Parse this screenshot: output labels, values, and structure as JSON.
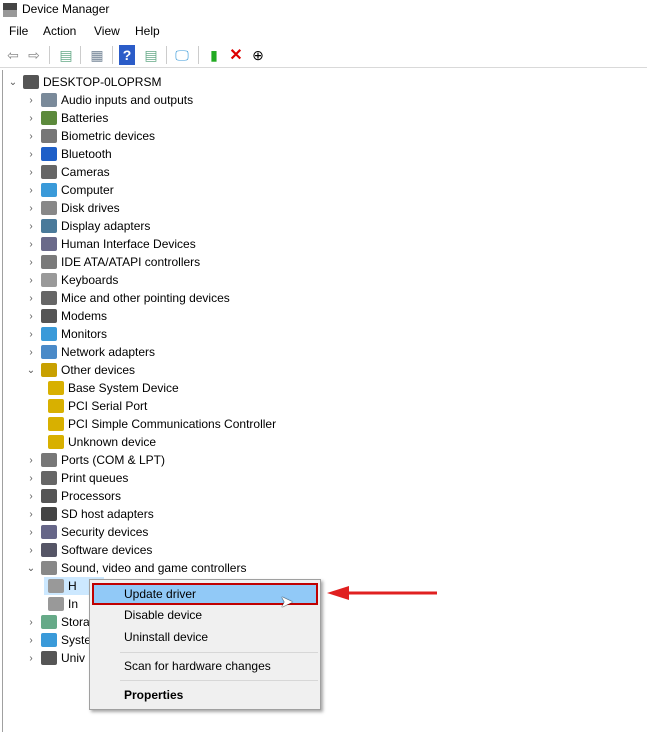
{
  "window": {
    "title": "Device Manager"
  },
  "menubar": [
    "File",
    "Action",
    "View",
    "Help"
  ],
  "toolbar": [
    "back-icon",
    "forward-icon",
    "show-hide-console-tree-icon",
    "properties-icon",
    "help-icon",
    "action-pane-icon",
    "scan-hardware-icon",
    "update-driver-icon",
    "uninstall-icon",
    "disable-icon"
  ],
  "tree": {
    "root": "DESKTOP-0LOPRSM",
    "items": [
      {
        "label": "Audio inputs and outputs",
        "icon": "speaker-icon",
        "expanded": false
      },
      {
        "label": "Batteries",
        "icon": "battery-icon",
        "expanded": false
      },
      {
        "label": "Biometric devices",
        "icon": "fingerprint-icon",
        "expanded": false
      },
      {
        "label": "Bluetooth",
        "icon": "bluetooth-icon",
        "expanded": false
      },
      {
        "label": "Cameras",
        "icon": "camera-icon",
        "expanded": false
      },
      {
        "label": "Computer",
        "icon": "computer-icon",
        "expanded": false
      },
      {
        "label": "Disk drives",
        "icon": "disk-icon",
        "expanded": false
      },
      {
        "label": "Display adapters",
        "icon": "display-adapter-icon",
        "expanded": false
      },
      {
        "label": "Human Interface Devices",
        "icon": "hid-icon",
        "expanded": false
      },
      {
        "label": "IDE ATA/ATAPI controllers",
        "icon": "ide-icon",
        "expanded": false
      },
      {
        "label": "Keyboards",
        "icon": "keyboard-icon",
        "expanded": false
      },
      {
        "label": "Mice and other pointing devices",
        "icon": "mouse-icon",
        "expanded": false
      },
      {
        "label": "Modems",
        "icon": "modem-icon",
        "expanded": false
      },
      {
        "label": "Monitors",
        "icon": "monitor-icon",
        "expanded": false
      },
      {
        "label": "Network adapters",
        "icon": "network-icon",
        "expanded": false
      },
      {
        "label": "Other devices",
        "icon": "unknown-device-icon",
        "expanded": true,
        "children": [
          "Base System Device",
          "PCI Serial Port",
          "PCI Simple Communications Controller",
          "Unknown device"
        ]
      },
      {
        "label": "Ports (COM & LPT)",
        "icon": "port-icon",
        "expanded": false
      },
      {
        "label": "Print queues",
        "icon": "printer-icon",
        "expanded": false
      },
      {
        "label": "Processors",
        "icon": "processor-icon",
        "expanded": false
      },
      {
        "label": "SD host adapters",
        "icon": "sd-icon",
        "expanded": false
      },
      {
        "label": "Security devices",
        "icon": "security-icon",
        "expanded": false
      },
      {
        "label": "Software devices",
        "icon": "software-icon",
        "expanded": false
      },
      {
        "label": "Sound, video and game controllers",
        "icon": "speaker-icon",
        "expanded": true,
        "children": [
          "H",
          "In"
        ]
      },
      {
        "label": "Stora",
        "icon": "storage-icon",
        "expanded": false
      },
      {
        "label": "Syste",
        "icon": "system-icon",
        "expanded": false
      },
      {
        "label": "Univ",
        "icon": "usb-icon",
        "expanded": false
      }
    ]
  },
  "context_menu": {
    "items": [
      "Update driver",
      "Disable device",
      "Uninstall device",
      "Scan for hardware changes",
      "Properties"
    ],
    "highlighted": "Update driver"
  },
  "colors": {
    "highlight": "#91c9f7",
    "annotation": "#e02020"
  }
}
